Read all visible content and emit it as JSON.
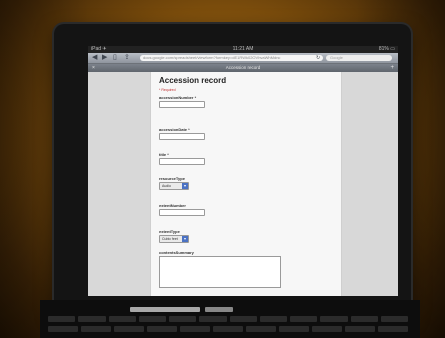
{
  "status_bar": {
    "carrier": "iPad ✈",
    "time": "11:21 AM",
    "battery": "81% ▭"
  },
  "toolbar": {
    "back_icon": "back-arrow",
    "forward_icon": "forward-arrow",
    "bookmarks_icon": "bookmarks",
    "share_icon": "share",
    "url": "docs.google.com/spreadsheet/viewform?formkey=dE1RWk02OVhvaWhMdnc",
    "reload_icon": "reload",
    "search_placeholder": "Google"
  },
  "tab": {
    "title": "Accession record"
  },
  "form": {
    "title": "Accession record",
    "required_note": "* Required",
    "fields": [
      {
        "label": "accessionNumber *",
        "type": "text"
      },
      {
        "label": "accessionDate *",
        "type": "text"
      },
      {
        "label": "title *",
        "type": "text"
      },
      {
        "label": "resourceType",
        "type": "select",
        "value": "Audio"
      },
      {
        "label": "extentNumber",
        "type": "text"
      },
      {
        "label": "extentType",
        "type": "select",
        "value": "Cubic feet"
      },
      {
        "label": "contentsSummary",
        "type": "textarea"
      }
    ]
  },
  "colors": {
    "backdrop": "#7a4c0c",
    "select_arrow": "#4b72c4",
    "required": "#c03030"
  }
}
